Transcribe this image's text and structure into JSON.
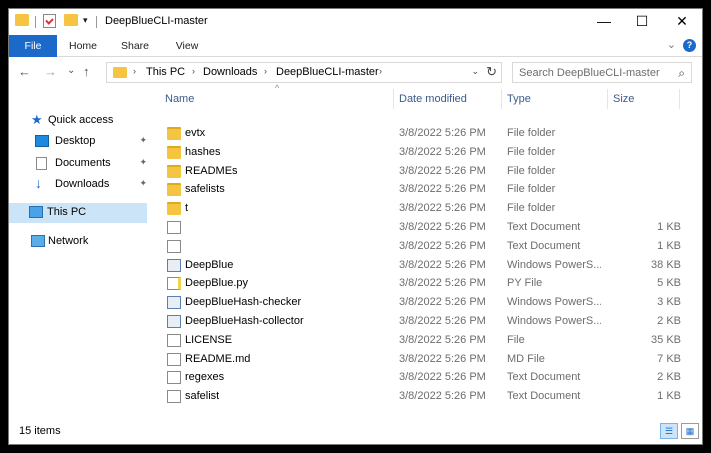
{
  "window": {
    "title": "DeepBlueCLI-master",
    "minimize": "—",
    "maximize": "☐",
    "close": "✕"
  },
  "ribbon": {
    "tabs": [
      "File",
      "Home",
      "Share",
      "View"
    ],
    "expand": "⌄",
    "help": "?"
  },
  "nav": {
    "back": "←",
    "forward": "→",
    "recent": "⌄",
    "up": "↑"
  },
  "address": {
    "crumbs": [
      "This PC",
      "Downloads",
      "DeepBlueCLI-master"
    ],
    "sep": "›",
    "dropdown": "⌄",
    "refresh": "↻"
  },
  "search": {
    "placeholder": "Search DeepBlueCLI-master",
    "icon": "⌕"
  },
  "sidebar": {
    "items": [
      {
        "label": "Quick access",
        "icon": "star-icon",
        "color": "#1b6ac9"
      },
      {
        "label": "Desktop",
        "icon": "desktop-icon",
        "pinned": "📌"
      },
      {
        "label": "Documents",
        "icon": "documents-icon",
        "pinned": "📌"
      },
      {
        "label": "Downloads",
        "icon": "downloads-icon",
        "pinned": "📌"
      },
      {
        "label": "This PC",
        "icon": "this-pc-icon",
        "selected": true
      },
      {
        "label": "Network",
        "icon": "network-icon"
      }
    ]
  },
  "columns": {
    "name": "Name",
    "date": "Date modified",
    "type": "Type",
    "size": "Size",
    "sort": "^"
  },
  "files": [
    {
      "name": "evtx",
      "date": "3/8/2022 5:26 PM",
      "type": "File folder",
      "size": "",
      "icon": "folder"
    },
    {
      "name": "hashes",
      "date": "3/8/2022 5:26 PM",
      "type": "File folder",
      "size": "",
      "icon": "folder"
    },
    {
      "name": "READMEs",
      "date": "3/8/2022 5:26 PM",
      "type": "File folder",
      "size": "",
      "icon": "folder"
    },
    {
      "name": "safelists",
      "date": "3/8/2022 5:26 PM",
      "type": "File folder",
      "size": "",
      "icon": "folder"
    },
    {
      "name": "t",
      "date": "3/8/2022 5:26 PM",
      "type": "File folder",
      "size": "",
      "icon": "folder"
    },
    {
      "name": "",
      "date": "3/8/2022 5:26 PM",
      "type": "Text Document",
      "size": "1 KB",
      "icon": "doc"
    },
    {
      "name": "",
      "date": "3/8/2022 5:26 PM",
      "type": "Text Document",
      "size": "1 KB",
      "icon": "doc"
    },
    {
      "name": "DeepBlue",
      "date": "3/8/2022 5:26 PM",
      "type": "Windows PowerS...",
      "size": "38 KB",
      "icon": "ps"
    },
    {
      "name": "DeepBlue.py",
      "date": "3/8/2022 5:26 PM",
      "type": "PY File",
      "size": "5 KB",
      "icon": "py"
    },
    {
      "name": "DeepBlueHash-checker",
      "date": "3/8/2022 5:26 PM",
      "type": "Windows PowerS...",
      "size": "3 KB",
      "icon": "ps"
    },
    {
      "name": "DeepBlueHash-collector",
      "date": "3/8/2022 5:26 PM",
      "type": "Windows PowerS...",
      "size": "2 KB",
      "icon": "ps"
    },
    {
      "name": "LICENSE",
      "date": "3/8/2022 5:26 PM",
      "type": "File",
      "size": "35 KB",
      "icon": "doc"
    },
    {
      "name": "README.md",
      "date": "3/8/2022 5:26 PM",
      "type": "MD File",
      "size": "7 KB",
      "icon": "doc"
    },
    {
      "name": "regexes",
      "date": "3/8/2022 5:26 PM",
      "type": "Text Document",
      "size": "2 KB",
      "icon": "doc"
    },
    {
      "name": "safelist",
      "date": "3/8/2022 5:26 PM",
      "type": "Text Document",
      "size": "1 KB",
      "icon": "doc"
    }
  ],
  "status": {
    "count": "15 items",
    "details_view": "☰",
    "large_icons_view": "▦"
  }
}
